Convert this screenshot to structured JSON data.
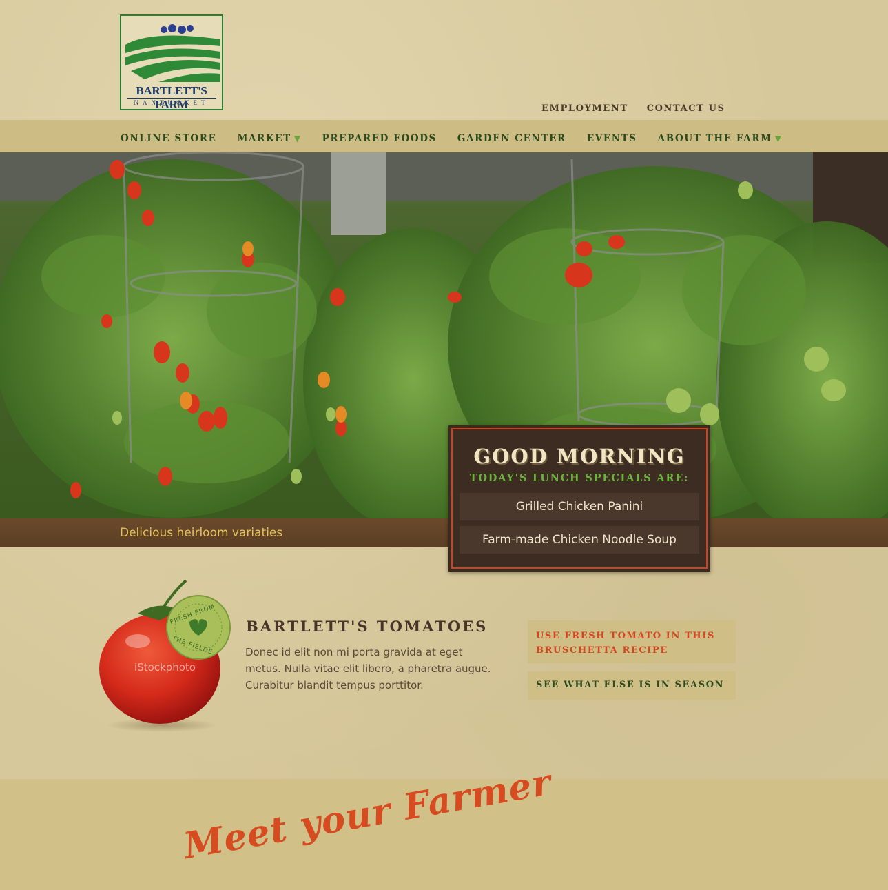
{
  "logo": {
    "title": "BARTLETT'S FARM",
    "subtitle": "NANTUCKET"
  },
  "utility_nav": [
    "EMPLOYMENT",
    "CONTACT US"
  ],
  "main_nav": [
    {
      "label": "ONLINE STORE",
      "has_dropdown": false
    },
    {
      "label": "MARKET",
      "has_dropdown": true
    },
    {
      "label": "PREPARED FOODS",
      "has_dropdown": false
    },
    {
      "label": "GARDEN CENTER",
      "has_dropdown": false
    },
    {
      "label": "EVENTS",
      "has_dropdown": false
    },
    {
      "label": "ABOUT THE FARM",
      "has_dropdown": true
    }
  ],
  "hero": {
    "caption": "Delicious heirloom variaties"
  },
  "lunch": {
    "greeting": "GOOD MORNING",
    "subtitle": "TODAY'S LUNCH SPECIALS ARE:",
    "specials": [
      "Grilled Chicken Panini",
      "Farm-made Chicken Noodle Soup"
    ]
  },
  "feature": {
    "badge_top": "FRESH FROM",
    "badge_bottom": "THE FIELDS",
    "watermark": "iStockphoto",
    "title": "BARTLETT'S TOMATOES",
    "body": "Donec id elit non mi porta gravida at eget metus. Nulla vitae elit libero, a pharetra augue. Curabitur blandit tempus porttitor.",
    "cta_recipe": "USE FRESH TOMATO IN THIS BRUSCHETTA RECIPE",
    "cta_season": "SEE WHAT ELSE IS IN SEASON"
  },
  "farmer": {
    "title": "Meet your Farmer"
  },
  "colors": {
    "accent": "#d64b20",
    "green": "#6db33f",
    "nav_text": "#2e4a1d",
    "brown": "#3a2a20"
  }
}
